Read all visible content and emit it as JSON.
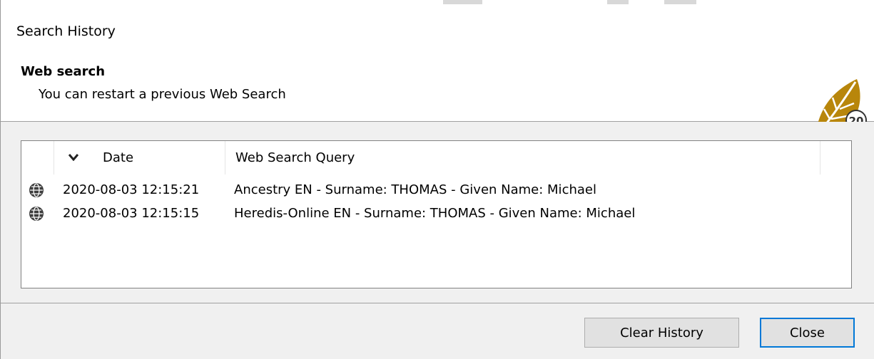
{
  "window": {
    "title": "Search History"
  },
  "header": {
    "title": "Web search",
    "subtitle": "You can restart a previous Web Search",
    "logo_icon": "leaf-2020-logo-icon",
    "logo_badge": "20"
  },
  "list": {
    "columns": {
      "date": "Date",
      "query": "Web Search Query",
      "sort_icon": "chevron-down-icon"
    },
    "rows": [
      {
        "icon": "globe-icon",
        "date": "2020-08-03 12:15:21",
        "query": "Ancestry EN - Surname: THOMAS - Given Name: Michael"
      },
      {
        "icon": "globe-icon",
        "date": "2020-08-03 12:15:15",
        "query": "Heredis-Online EN - Surname: THOMAS - Given Name: Michael"
      }
    ]
  },
  "footer": {
    "clear_label": "Clear History",
    "close_label": "Close"
  },
  "colors": {
    "accent": "#0078d7",
    "logo_gold": "#b8860b",
    "window_bg": "#f0f0f0"
  }
}
